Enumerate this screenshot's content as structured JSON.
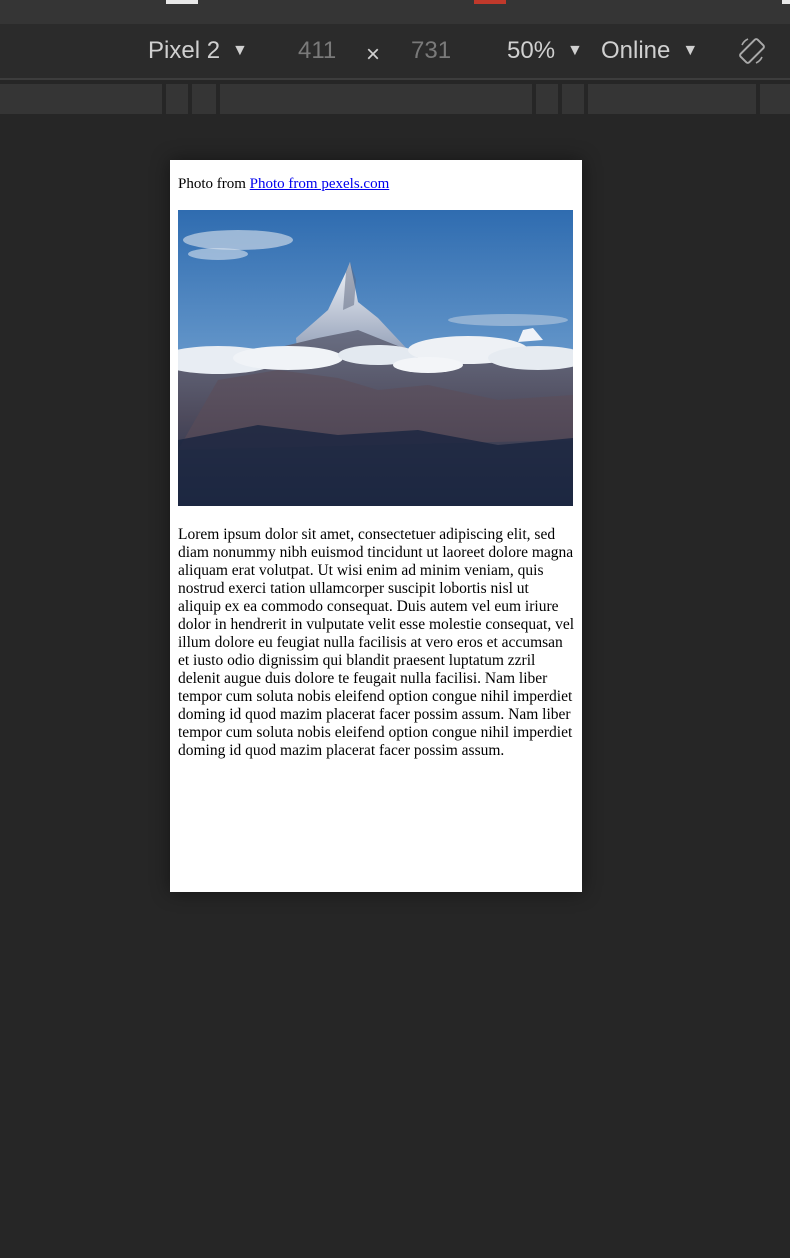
{
  "toolbar": {
    "device": "Pixel 2",
    "width": "411",
    "times": "×",
    "height": "731",
    "zoom": "50%",
    "network": "Online",
    "dropdown_arrow": "▼",
    "rotate_icon": "rotate-icon"
  },
  "page": {
    "caption_prefix": "Photo from",
    "caption_link": "Photo from pexels.com",
    "photo_icon": "mountain-photo",
    "paragraph": "Lorem ipsum dolor sit amet, consectetuer adipiscing elit, sed diam nonummy nibh euismod tincidunt ut laoreet dolore magna aliquam erat volutpat. Ut wisi enim ad minim veniam, quis nostrud exerci tation ullamcorper suscipit lobortis nisl ut aliquip ex ea commodo consequat. Duis autem vel eum iriure dolor in hendrerit in vulputate velit esse molestie consequat, vel illum dolore eu feugiat nulla facilisis at vero eros et accumsan et iusto odio dignissim qui blandit praesent luptatum zzril delenit augue duis dolore te feugait nulla facilisi. Nam liber tempor cum soluta nobis eleifend option congue nihil imperdiet doming id quod mazim placerat facer possim assum. Nam liber tempor cum soluta nobis eleifend option congue nihil imperdiet doming id quod mazim placerat facer possim assum."
  }
}
